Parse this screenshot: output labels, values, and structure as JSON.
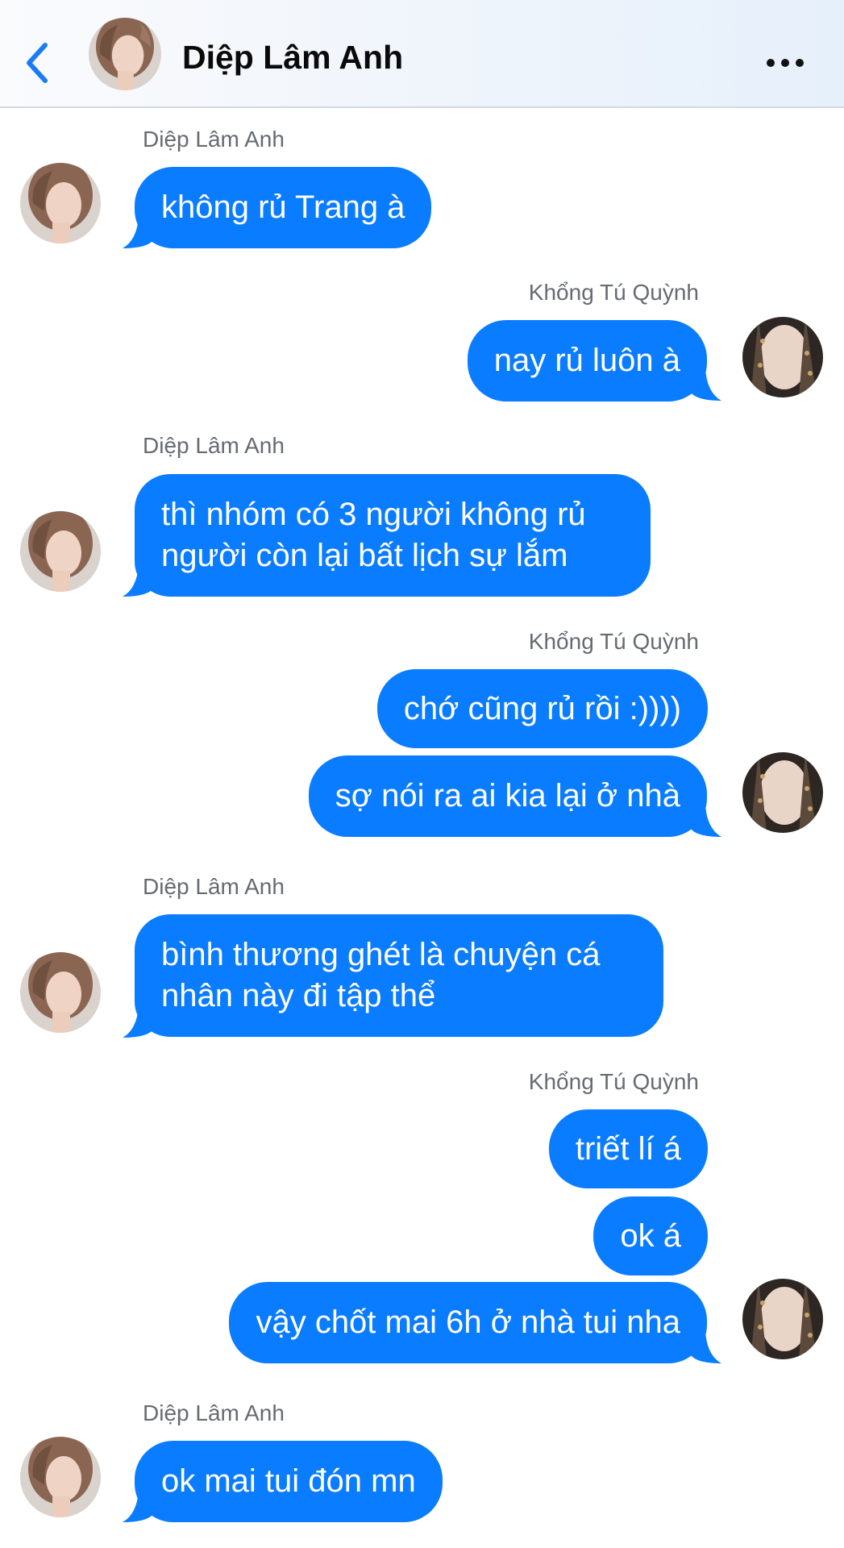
{
  "header": {
    "title": "Diệp Lâm Anh",
    "back_icon": "chevron-left-icon",
    "more_icon": "more-horizontal-icon",
    "accent": "#1a7cf5"
  },
  "participants": {
    "them": "Diệp Lâm Anh",
    "me": "Khổng Tú Quỳnh"
  },
  "bubble_color": "#0a7cff",
  "messages": [
    {
      "sender": "Diệp Lâm Anh",
      "texts": [
        "không rủ Trang à"
      ]
    },
    {
      "sender": "Khổng Tú Quỳnh",
      "texts": [
        "nay rủ luôn à"
      ]
    },
    {
      "sender": "Diệp Lâm Anh",
      "texts": [
        "thì nhóm có 3 người không rủ\nngười còn lại bất lịch sự lắm"
      ]
    },
    {
      "sender": "Khổng Tú Quỳnh",
      "texts": [
        "chớ cũng rủ rồi :))))",
        "sợ nói ra ai kia lại ở nhà"
      ]
    },
    {
      "sender": "Diệp Lâm Anh",
      "texts": [
        "bình thương ghét là chuyện cá\nnhân này đi tập thể"
      ]
    },
    {
      "sender": "Khổng Tú Quỳnh",
      "texts": [
        "triết lí á",
        "ok á",
        "vậy chốt mai 6h ở nhà tui nha"
      ]
    },
    {
      "sender": "Diệp Lâm Anh",
      "texts": [
        "ok mai tui đón mn"
      ]
    }
  ]
}
